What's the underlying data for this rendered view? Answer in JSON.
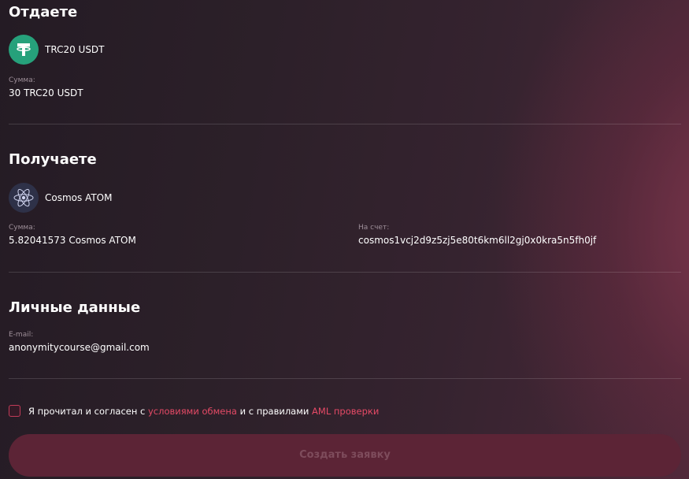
{
  "give": {
    "title": "Отдаете",
    "currency": "TRC20 USDT",
    "amount_label": "Сумма:",
    "amount_value": "30 TRC20 USDT"
  },
  "receive": {
    "title": "Получаете",
    "currency": "Cosmos ATOM",
    "amount_label": "Сумма:",
    "amount_value": "5.82041573 Cosmos ATOM",
    "account_label": "На счет:",
    "account_value": "cosmos1vcj2d9z5zj5e80t6km6ll2gj0x0kra5n5fh0jf"
  },
  "personal": {
    "title": "Личные данные",
    "email_label": "E-mail:",
    "email_value": "anonymitycourse@gmail.com"
  },
  "agreement": {
    "prefix": "Я прочитал и согласен с ",
    "terms_link": "условиями обмена",
    "middle": " и с правилами ",
    "aml_link": "AML проверки",
    "checked": false
  },
  "submit": {
    "label": "Создать заявку",
    "enabled": false
  },
  "colors": {
    "accent": "#e54a66",
    "usdt": "#26a17b",
    "button_bg": "#5c2436"
  },
  "icons": {
    "usdt": "tether-icon",
    "atom": "cosmos-atom-icon"
  }
}
